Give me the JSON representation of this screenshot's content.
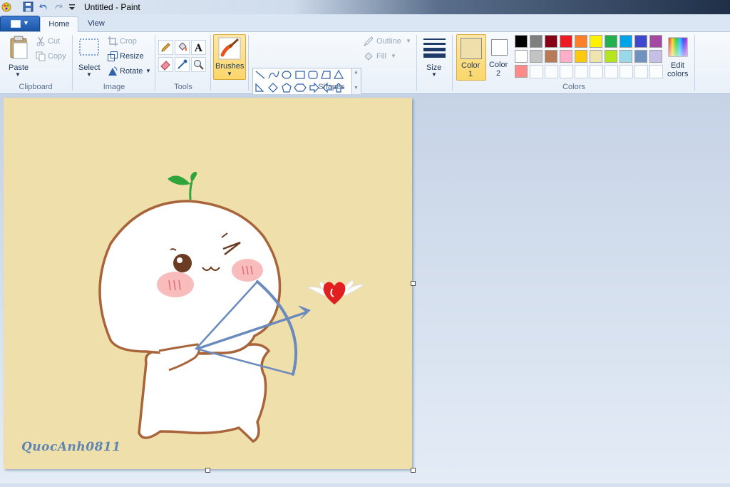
{
  "window": {
    "title": "Untitled - Paint"
  },
  "tabs": [
    {
      "label": "Home",
      "active": true
    },
    {
      "label": "View",
      "active": false
    }
  ],
  "clipboard": {
    "paste_label": "Paste",
    "cut_label": "Cut",
    "copy_label": "Copy",
    "group_label": "Clipboard"
  },
  "image": {
    "select_label": "Select",
    "crop_label": "Crop",
    "resize_label": "Resize",
    "rotate_label": "Rotate",
    "group_label": "Image"
  },
  "tools": {
    "group_label": "Tools",
    "items": [
      "pencil-icon",
      "fill-bucket-icon",
      "text-icon",
      "eraser-icon",
      "color-picker-icon",
      "magnifier-icon"
    ]
  },
  "brushes": {
    "label": "Brushes"
  },
  "shapes": {
    "group_label": "Shapes",
    "outline_label": "Outline",
    "fill_label": "Fill"
  },
  "size": {
    "label": "Size"
  },
  "colors": {
    "color1_label": "Color",
    "color1_num": "1",
    "color2_label": "Color",
    "color2_num": "2",
    "color1_value": "#efe0ab",
    "color2_value": "#ffffff",
    "edit_label_1": "Edit",
    "edit_label_2": "colors",
    "group_label": "Colors",
    "palette_row1": [
      "#000000",
      "#7f7f7f",
      "#880015",
      "#ed1c24",
      "#ff7f27",
      "#fff200",
      "#22b14c",
      "#00a2e8",
      "#3f48cc",
      "#a349a4"
    ],
    "palette_row2": [
      "#ffffff",
      "#c3c3c3",
      "#b97a57",
      "#ffaec9",
      "#ffc90e",
      "#efe4b0",
      "#b5e61d",
      "#99d9ea",
      "#7092be",
      "#c8bfe7"
    ],
    "palette_row3": [
      "#ff8a8a"
    ]
  },
  "canvas": {
    "background": "#efe0ab",
    "signature": "QuocAnh0811"
  }
}
